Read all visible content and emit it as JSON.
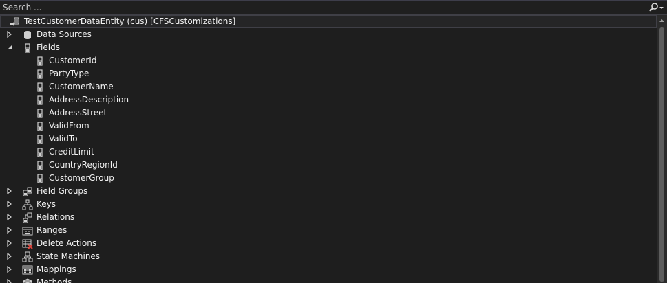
{
  "search": {
    "placeholder": "Search ..."
  },
  "tree": {
    "root": {
      "label": "TestCustomerDataEntity (cus) [CFSCustomizations]"
    },
    "nodes": [
      {
        "label": "Data Sources",
        "icon": "database-icon",
        "expanded": false
      },
      {
        "label": "Fields",
        "icon": "field-icon",
        "expanded": true,
        "children": [
          {
            "label": "CustomerId",
            "icon": "field-icon"
          },
          {
            "label": "PartyType",
            "icon": "field-icon"
          },
          {
            "label": "CustomerName",
            "icon": "field-icon"
          },
          {
            "label": "AddressDescription",
            "icon": "field-icon"
          },
          {
            "label": "AddressStreet",
            "icon": "field-icon"
          },
          {
            "label": "ValidFrom",
            "icon": "field-icon"
          },
          {
            "label": "ValidTo",
            "icon": "field-icon"
          },
          {
            "label": "CreditLimit",
            "icon": "field-icon"
          },
          {
            "label": "CountryRegionId",
            "icon": "field-icon"
          },
          {
            "label": "CustomerGroup",
            "icon": "field-icon"
          }
        ]
      },
      {
        "label": "Field Groups",
        "icon": "field-groups-icon",
        "expanded": false
      },
      {
        "label": "Keys",
        "icon": "keys-icon",
        "expanded": false
      },
      {
        "label": "Relations",
        "icon": "relations-icon",
        "expanded": false
      },
      {
        "label": "Ranges",
        "icon": "ranges-icon",
        "expanded": false
      },
      {
        "label": "Delete Actions",
        "icon": "delete-actions-icon",
        "expanded": false
      },
      {
        "label": "State Machines",
        "icon": "state-machines-icon",
        "expanded": false
      },
      {
        "label": "Mappings",
        "icon": "mappings-icon",
        "expanded": false
      },
      {
        "label": "Methods",
        "icon": "methods-icon",
        "expanded": false
      }
    ]
  },
  "colors": {
    "background": "#1e1e1e",
    "text": "#f1f1f1",
    "selection_border": "#3f3f46",
    "delete_red": "#e0453d"
  }
}
